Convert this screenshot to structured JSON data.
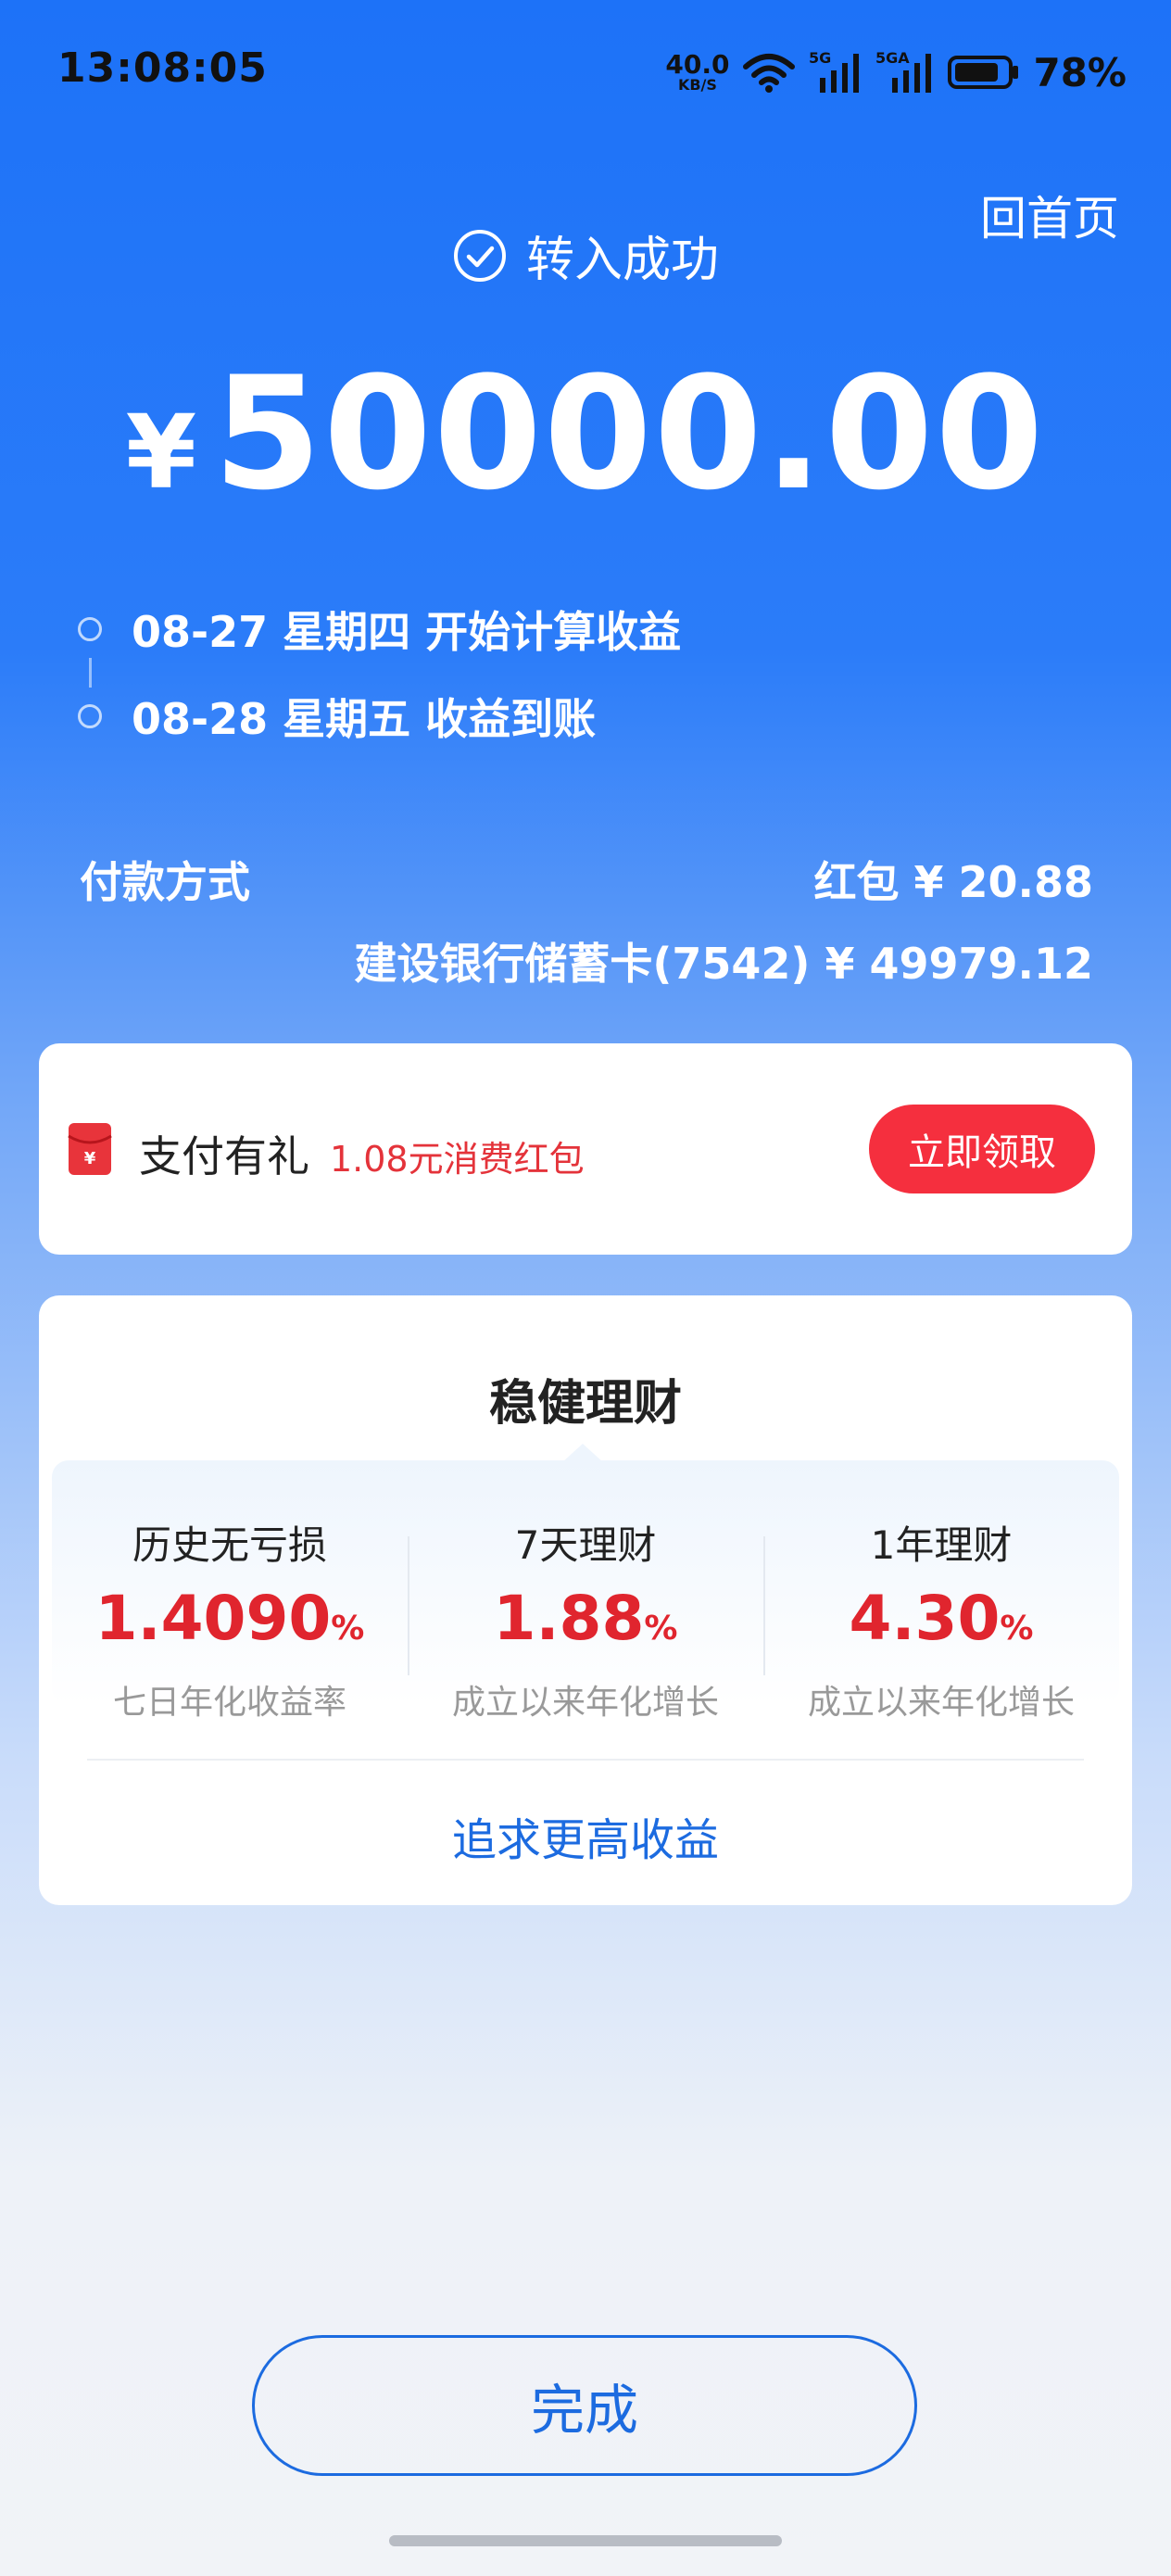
{
  "status_bar": {
    "time": "13:08:05",
    "net_speed": "40.0",
    "net_unit": "KB/S",
    "sig1": "5G",
    "sig2": "5GA",
    "battery": "78%"
  },
  "header": {
    "home_link": "回首页",
    "success_text": "转入成功",
    "currency": "¥",
    "amount": "50000.00"
  },
  "timeline": [
    {
      "text": "08-27 星期四 开始计算收益"
    },
    {
      "text": "08-28 星期五 收益到账"
    }
  ],
  "payment": {
    "label": "付款方式",
    "line1": "红包 ¥ 20.88",
    "line2": "建设银行储蓄卡(7542) ¥ 49979.12"
  },
  "gift": {
    "title": "支付有礼",
    "promo": "1.08元消费红包",
    "button": "立即领取"
  },
  "finance": {
    "title": "稳健理财",
    "products": [
      {
        "name": "历史无亏损",
        "rate": "1.4090",
        "unit": "%",
        "sub": "七日年化收益率"
      },
      {
        "name": "7天理财",
        "rate": "1.88",
        "unit": "%",
        "sub": "成立以来年化增长"
      },
      {
        "name": "1年理财",
        "rate": "4.30",
        "unit": "%",
        "sub": "成立以来年化增长"
      }
    ],
    "more": "追求更高收益"
  },
  "done_button": "完成",
  "colors": {
    "brand_blue": "#1d72f8",
    "link_blue": "#1c6be0",
    "red": "#e0252e",
    "button_red": "#f52f3e"
  }
}
